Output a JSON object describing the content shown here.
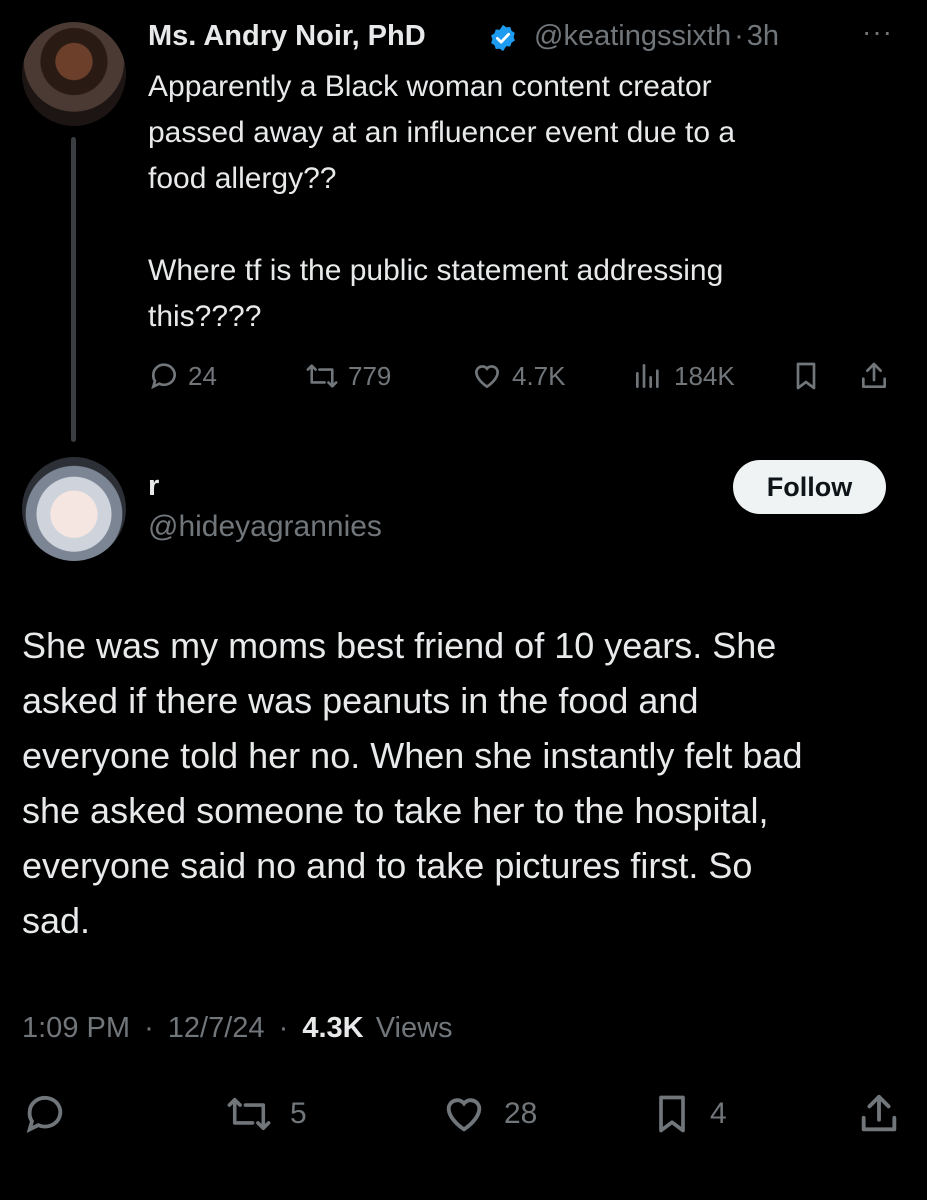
{
  "parent_tweet": {
    "author_name": "Ms. Andry Noir, PhD",
    "handle": "@keatingssixth",
    "separator": "·",
    "time": "3h",
    "more_label": "···",
    "text": "Apparently a Black woman content creator\npassed away at an influencer event due to a\nfood allergy??\n\nWhere tf is the public statement addressing\nthis????",
    "replies": "24",
    "reposts": "779",
    "likes": "4.7K",
    "views": "184K",
    "verified": true
  },
  "reply_tweet": {
    "author_name": "r",
    "handle": "@hideyagrannies",
    "follow_label": "Follow",
    "text": "She was my moms best friend of 10 years. She\nasked if there was peanuts in the food and\neveryone told her no. When she instantly felt bad\nshe asked someone to take her to the hospital,\neveryone said no and to take pictures first. So\nsad.",
    "time": "1:09 PM",
    "dot": "·",
    "date": "12/7/24",
    "dot2": "·",
    "views_count": "4.3K",
    "views_label": "Views",
    "reposts": "5",
    "likes": "28",
    "bookmarks": "4"
  },
  "icons": {
    "reply": "reply-icon",
    "repost": "repost-icon",
    "like": "heart-icon",
    "views": "views-icon",
    "bookmark": "bookmark-icon",
    "share": "share-icon",
    "verified": "verified-badge-icon"
  },
  "colors": {
    "background": "#000000",
    "text": "#e7e9ea",
    "muted": "#71767b",
    "verified": "#1d9bf0",
    "follow_bg": "#eff3f4"
  }
}
